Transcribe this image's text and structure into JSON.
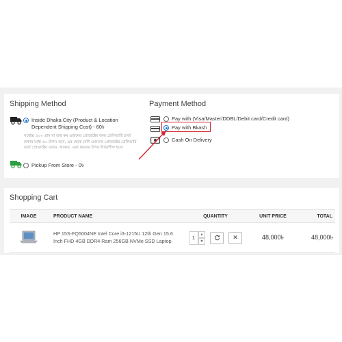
{
  "shipping": {
    "title": "Shipping Method",
    "inside_label": "Inside Dhaka City (Product & Location Dependent Shipping Cost) - 60৳",
    "note": "সর্বোচ্চ ৫০০ গ্রাম বা তার কম ওজনের প্রোডাক্টের জন্য ডেলিভারি চার্জ ঢাকার মধ্যে ৬০ টাকা। তবে, এর থেকে বেশি ওজনের প্রোডাক্টের ডেলিভারি চার্জ প্রোডাক্টের ওজন, আকার, এবং ধরনের উপর নির্ভরশীল হবে।",
    "pickup_label": "Pickup From Store - 0৳",
    "selected": "inside"
  },
  "payment": {
    "title": "Payment Method",
    "options": [
      {
        "label": "Pay with (Visa/Master/DDBL/Debit card/Credit card)",
        "icon": "credit-card-icon"
      },
      {
        "label": "Pay with Bkash",
        "icon": "bkash-card-icon"
      },
      {
        "label": "Cash On Delivery",
        "icon": "cash-icon"
      }
    ],
    "selected_index": 1,
    "highlight_color": "#d3232f"
  },
  "cart": {
    "title": "Shopping Cart",
    "headers": {
      "image": "IMAGE",
      "product_name": "PRODUCT NAME",
      "quantity": "QUANTITY",
      "unit_price": "UNIT PRICE",
      "total": "TOTAL"
    },
    "rows": [
      {
        "image_icon": "laptop-image",
        "product_name": "HP 15S-FQ5004NE Intel Core i3-1215U 12th Gen 15.6 Inch FHD 4GB DDR4 Ram 256GB NVMe SSD Laptop",
        "quantity": "1",
        "unit_price": "48,000৳",
        "total": "48,000৳"
      }
    ]
  },
  "colors": {
    "accent": "#1e73d6",
    "annotation": "#d3232f",
    "background_band": "#f1f1f1"
  }
}
